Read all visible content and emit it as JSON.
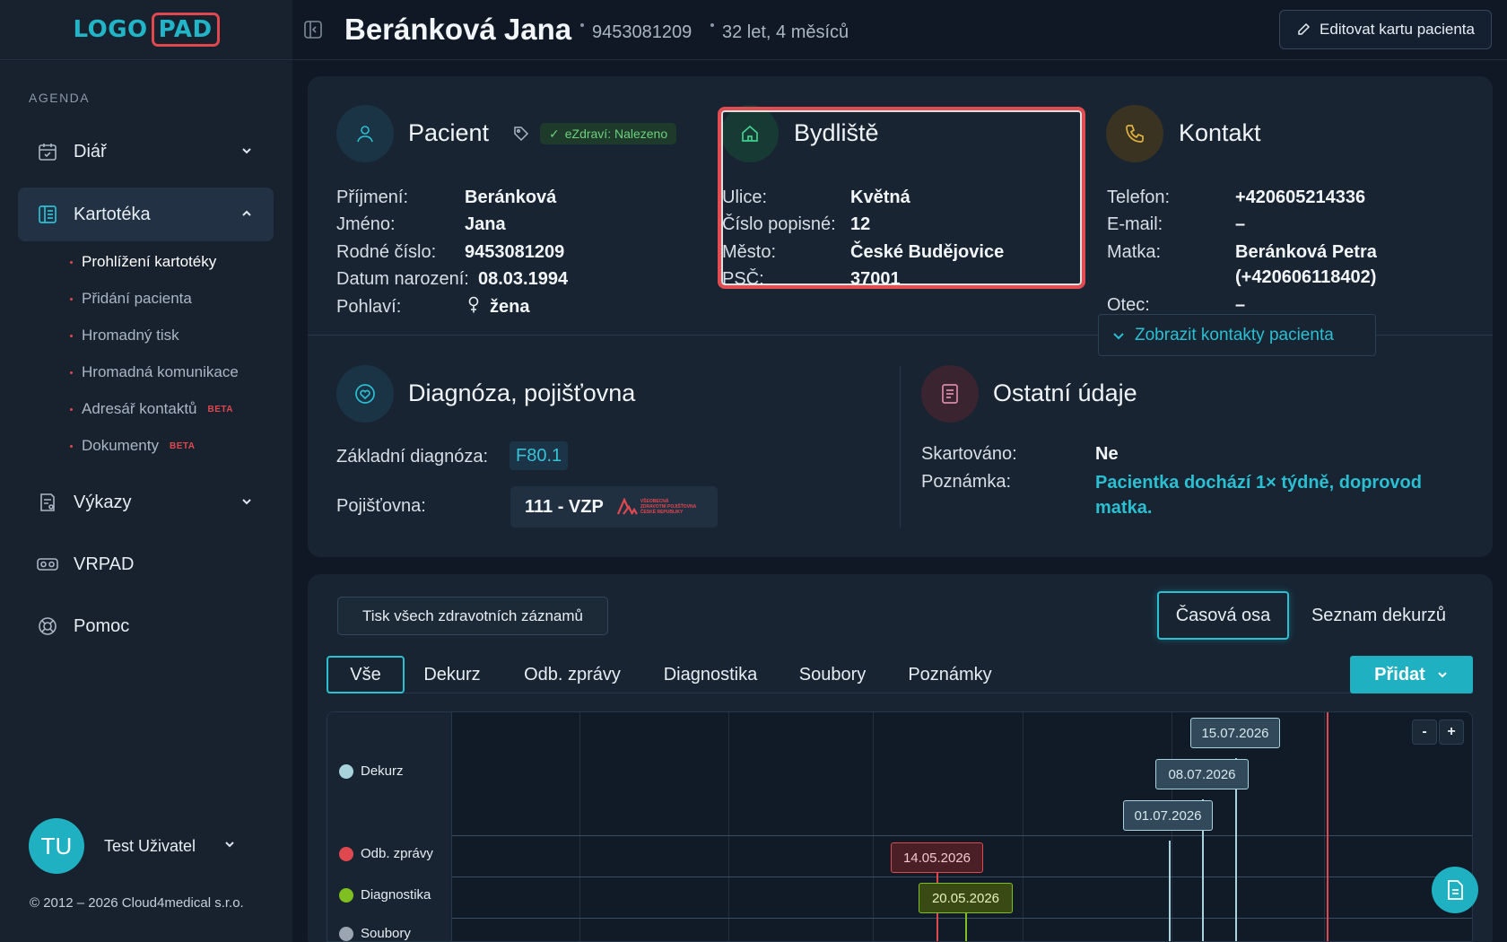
{
  "app": {
    "logo_left": "LOGO",
    "logo_right": "PAD"
  },
  "sidebar": {
    "section": "AGENDA",
    "items": [
      {
        "label": "Diář",
        "icon": "calendar-icon"
      },
      {
        "label": "Kartotéka",
        "icon": "book-icon"
      },
      {
        "label": "Výkazy",
        "icon": "report-icon"
      },
      {
        "label": "VRPAD",
        "icon": "vr-icon"
      },
      {
        "label": "Pomoc",
        "icon": "help-icon"
      }
    ],
    "sub_items": [
      {
        "label": "Prohlížení kartotéky",
        "beta": ""
      },
      {
        "label": "Přidání pacienta",
        "beta": ""
      },
      {
        "label": "Hromadný tisk",
        "beta": ""
      },
      {
        "label": "Hromadná komunikace",
        "beta": ""
      },
      {
        "label": "Adresář kontaktů",
        "beta": "BETA"
      },
      {
        "label": "Dokumenty",
        "beta": "BETA"
      }
    ],
    "user": {
      "initials": "TU",
      "name": "Test Uživatel"
    },
    "copyright": "© 2012 – 2026 Cloud4medical s.r.o."
  },
  "header": {
    "patient_name": "Beránková Jana",
    "birth_number": "9453081209",
    "age": "32 let, 4 měsíců",
    "edit_label": "Editovat kartu pacienta"
  },
  "patient": {
    "title": "Pacient",
    "ezdravi": "eZdraví: Nalezeno",
    "fields": [
      {
        "label": "Příjmení:",
        "value": "Beránková"
      },
      {
        "label": "Jméno:",
        "value": "Jana"
      },
      {
        "label": "Rodné číslo:",
        "value": "9453081209"
      },
      {
        "label": "Datum narození:",
        "value": "08.03.1994"
      },
      {
        "label": "Pohlaví:",
        "value": "žena"
      }
    ]
  },
  "residence": {
    "title": "Bydliště",
    "fields": [
      {
        "label": "Ulice:",
        "value": "Květná"
      },
      {
        "label": "Číslo popisné:",
        "value": "12"
      },
      {
        "label": "Město:",
        "value": "České Budějovice"
      },
      {
        "label": "PSČ:",
        "value": "37001"
      }
    ]
  },
  "contact": {
    "title": "Kontakt",
    "fields": [
      {
        "label": "Telefon:",
        "value": "+420605214336"
      },
      {
        "label": "E-mail:",
        "value": "–"
      },
      {
        "label": "Matka:",
        "value": "Beránková Petra",
        "value2": "(+420606118402)"
      },
      {
        "label": "Otec:",
        "value": "–"
      }
    ],
    "show_contacts": "Zobrazit kontakty pacienta"
  },
  "diagnosis": {
    "title": "Diagnóza, pojišťovna",
    "base_label": "Základní diagnóza:",
    "base_value": "F80.1",
    "insurance_label": "Pojišťovna:",
    "insurance_value": "111 - VZP",
    "insurance_logo_text": [
      "VŠEOBECNÁ",
      "ZDRAVOTNÍ POJIŠŤOVNA",
      "ČESKÉ REPUBLIKY"
    ]
  },
  "other": {
    "title": "Ostatní údaje",
    "shredded_label": "Skartováno:",
    "shredded_value": "Ne",
    "note_label": "Poznámka:",
    "note_value": "Pacientka dochází 1× týdně, doprovod matka."
  },
  "records": {
    "print_all": "Tisk všech zdravotních záznamů",
    "view_timeline": "Časová osa",
    "view_list": "Seznam dekurzů",
    "tabs": [
      "Vše",
      "Dekurz",
      "Odb. zprávy",
      "Diagnostika",
      "Soubory",
      "Poznámky"
    ],
    "add": "Přidat",
    "zoom_out": "-",
    "zoom_in": "+"
  },
  "timeline": {
    "rows": [
      {
        "label": "Dekurz",
        "color": "#a9d3dc"
      },
      {
        "label": "Odb. zprávy",
        "color": "#e0484f"
      },
      {
        "label": "Diagnostika",
        "color": "#7fbf1f"
      },
      {
        "label": "Soubory",
        "color": "#9aa5b1"
      }
    ],
    "items": [
      {
        "row": "Dekurz",
        "date": "15.07.2026"
      },
      {
        "row": "Dekurz",
        "date": "08.07.2026"
      },
      {
        "row": "Dekurz",
        "date": "01.07.2026"
      },
      {
        "row": "Odb. zprávy",
        "date": "14.05.2026"
      },
      {
        "row": "Diagnostika",
        "date": "20.05.2026"
      }
    ]
  },
  "colors": {
    "accent": "#1fb0c2",
    "highlight": "#e04c50"
  }
}
